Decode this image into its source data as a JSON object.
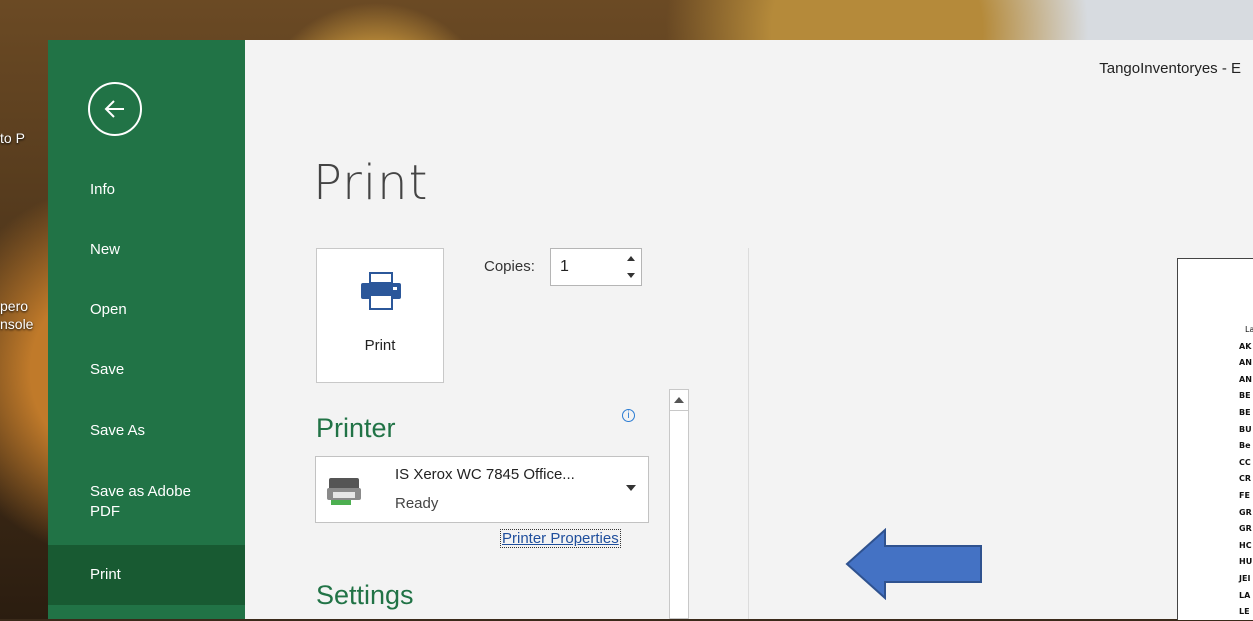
{
  "desktop": {
    "icons": [
      {
        "label": "to P"
      },
      {
        "label": "pero"
      },
      {
        "label": "nsole"
      }
    ]
  },
  "window": {
    "doc_title": "TangoInventoryes - E"
  },
  "sidebar": {
    "back_icon": "back-arrow-icon",
    "items": [
      {
        "label": "Info"
      },
      {
        "label": "New"
      },
      {
        "label": "Open"
      },
      {
        "label": "Save"
      },
      {
        "label": "Save As"
      },
      {
        "label": "Save as Adobe PDF"
      },
      {
        "label": "Print"
      }
    ],
    "active": "Print",
    "colors": {
      "bg": "#217346",
      "active_bg": "#185a32"
    }
  },
  "main": {
    "heading": "Print",
    "print_button": {
      "label": "Print",
      "icon": "printer-icon"
    },
    "copies": {
      "label": "Copies:",
      "value": "1"
    },
    "printer_section": {
      "heading": "Printer",
      "info_icon": "info-icon",
      "selected_printer": {
        "name": "IS Xerox WC 7845 Office...",
        "status": "Ready",
        "icon": "printer-device-icon"
      },
      "properties_link": "Printer Properties"
    },
    "settings_section": {
      "heading": "Settings"
    },
    "preview": {
      "rows": [
        "La",
        "AK",
        "AN",
        "AN",
        "BE",
        "BE",
        "BU",
        "Be",
        "CC",
        "CR",
        "FE",
        "GR",
        "GR",
        "HC",
        "HU",
        "JEI",
        "LA",
        "LE"
      ]
    }
  },
  "annotation": {
    "arrow_color": "#4472c4"
  }
}
